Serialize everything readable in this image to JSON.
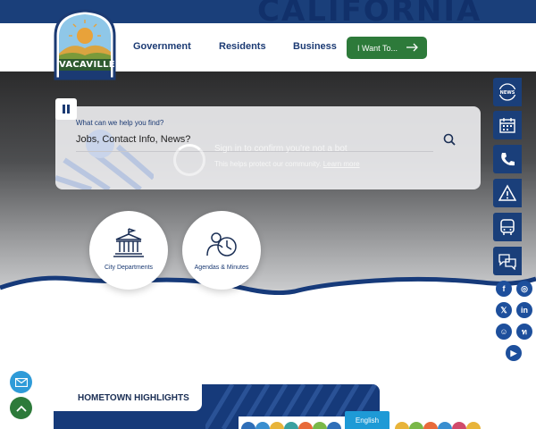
{
  "header": {
    "background_word": "CALIFORNIA",
    "logo_text": "VACAVILLE",
    "nav": [
      "Government",
      "Residents",
      "Business"
    ],
    "cta_label": "I Want To..."
  },
  "search": {
    "label": "What can we help you find?",
    "value": "Jobs, Contact Info, News?"
  },
  "recaptcha": {
    "title": "Sign in to confirm you're not a bot",
    "sub": "This helps protect our community.",
    "link": "Learn more"
  },
  "quick_links": [
    {
      "label": "City Departments",
      "icon": "city-hall-icon"
    },
    {
      "label": "Agendas & Minutes",
      "icon": "person-clock-icon"
    }
  ],
  "right_rail": [
    {
      "icon": "news-globe-icon",
      "text": "NEWS"
    },
    {
      "icon": "calendar-icon"
    },
    {
      "icon": "phone-card-icon"
    },
    {
      "icon": "alert-triangle-icon"
    },
    {
      "icon": "bus-icon"
    },
    {
      "icon": "chat-bubbles-icon"
    }
  ],
  "social": [
    {
      "icon": "facebook-icon",
      "glyph": "f"
    },
    {
      "icon": "instagram-icon",
      "glyph": "◎"
    },
    {
      "icon": "x-icon",
      "glyph": "𝕏"
    },
    {
      "icon": "linkedin-icon",
      "glyph": "in"
    },
    {
      "icon": "nextdoor-icon",
      "glyph": "☺"
    },
    {
      "icon": "threads-icon",
      "glyph": "ท"
    },
    {
      "icon": "youtube-icon",
      "glyph": "▶"
    }
  ],
  "hometown": {
    "title": "HOMETOWN HIGHLIGHTS"
  },
  "language_button": "English",
  "colors": {
    "navy": "#1a3f7a",
    "green": "#2d7a3a",
    "light_blue": "#2f9bd8"
  }
}
